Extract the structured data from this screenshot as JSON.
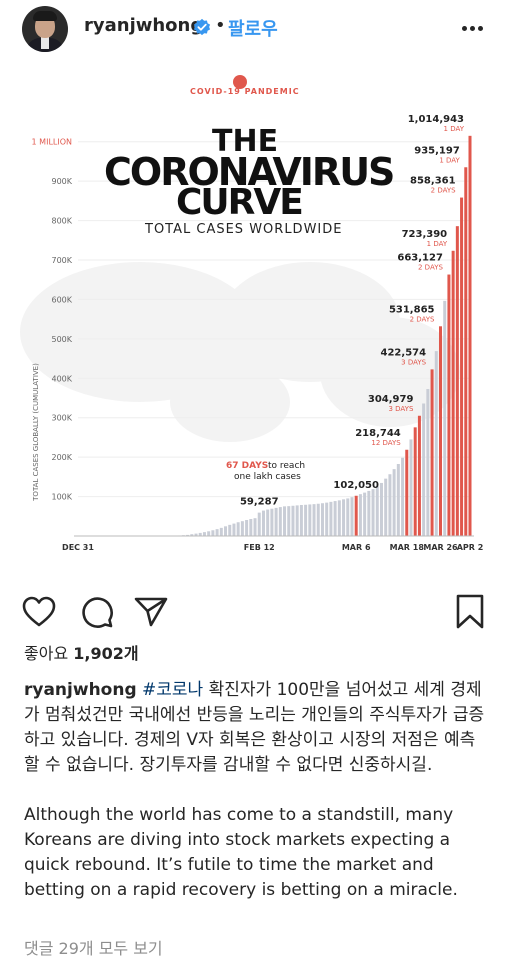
{
  "post": {
    "username": "ryanjwhong",
    "separator": "•",
    "follow_label": "팔로우",
    "likes_prefix": "좋아요",
    "likes_count": "1,902개",
    "caption_user": "ryanjwhong",
    "caption_hashtag": "#코로나",
    "caption_korean": " 확진자가 100만을 넘어섰고 세계 경제가 멈춰섰건만 국내에선 반등을 노리는 개인들의 주식투자가 급증하고 있습니다. 경제의 V자 회복은 환상이고 시장의 저점은 예측할 수 없습니다. 장기투자를 감내할 수 없다면 신중하시길.",
    "caption_english": "Although the world has come to a standstill, many Koreans are diving into stock markets expecting a quick rebound. It’s futile to time the market and betting on a rapid recovery is betting on a miracle.",
    "view_comments": "댓글 29개 모두 보기"
  },
  "colors": {
    "accent_blue": "#3897f0",
    "hashtag": "#00376b",
    "bar_gray": "#c9cdd6",
    "bar_red": "#e0574c",
    "muted": "#8e8e8e"
  },
  "icons": {
    "more": "more-horizontal-icon",
    "like": "heart-icon",
    "comment": "comment-bubble-icon",
    "share": "paper-plane-icon",
    "save": "bookmark-icon",
    "verified": "verified-badge-icon"
  },
  "chart_data": {
    "type": "bar",
    "title_lines": [
      "THE",
      "CORONAVIRUS",
      "CURVE"
    ],
    "subtitle": "TOTAL CASES WORLDWIDE",
    "badge": "COVID-19 PANDEMIC",
    "ylabel": "TOTAL CASES GLOBALLY (CUMULATIVE)",
    "ylim": [
      0,
      1050000
    ],
    "y_ticks": [
      {
        "value": 100000,
        "label": "100K"
      },
      {
        "value": 200000,
        "label": "200K"
      },
      {
        "value": 300000,
        "label": "300K"
      },
      {
        "value": 400000,
        "label": "400K"
      },
      {
        "value": 500000,
        "label": "500K"
      },
      {
        "value": 600000,
        "label": "600K"
      },
      {
        "value": 700000,
        "label": "700K"
      },
      {
        "value": 800000,
        "label": "800K"
      },
      {
        "value": 900000,
        "label": "900K"
      },
      {
        "value": 1000000,
        "label": "1 MILLION"
      }
    ],
    "x_labels": [
      {
        "day": 0,
        "label": "DEC 31"
      },
      {
        "day": 43,
        "label": "FEB 12"
      },
      {
        "day": 66,
        "label": "MAR 6"
      },
      {
        "day": 78,
        "label": "MAR 18"
      },
      {
        "day": 86,
        "label": "MAR 26"
      },
      {
        "day": 93,
        "label": "APR 2"
      }
    ],
    "days": 93,
    "values": [
      27,
      27,
      44,
      44,
      59,
      59,
      59,
      59,
      59,
      59,
      59,
      59,
      59,
      59,
      59,
      59,
      59,
      59,
      59,
      59,
      282,
      314,
      581,
      846,
      1320,
      2014,
      2798,
      4593,
      6065,
      7818,
      9826,
      11953,
      14557,
      17391,
      20630,
      24554,
      28276,
      31481,
      34886,
      37558,
      40554,
      43103,
      45171,
      59287,
      64438,
      67100,
      69197,
      71329,
      73332,
      75184,
      75700,
      76677,
      77673,
      78651,
      79205,
      80087,
      80828,
      81820,
      83112,
      84615,
      86604,
      88585,
      90443,
      93016,
      95314,
      98425,
      102050,
      106099,
      109991,
      114381,
      118948,
      126214,
      134576,
      145483,
      156653,
      169593,
      182605,
      198412,
      218744,
      244902,
      275550,
      304979,
      336075,
      372757,
      422574,
      468905,
      531865,
      596366,
      663127,
      723390,
      785807,
      858361,
      935197,
      1014943
    ],
    "red_days": [
      66,
      78,
      80,
      81,
      84,
      86,
      88,
      89,
      90,
      91,
      92,
      93
    ],
    "annotations": [
      {
        "day": 43,
        "value": "59,287",
        "note": ""
      },
      {
        "day": 66,
        "value": "102,050",
        "note": ""
      },
      {
        "day": 78,
        "value": "218,744",
        "note": "12 DAYS"
      },
      {
        "day": 81,
        "value": "304,979",
        "note": "3 DAYS"
      },
      {
        "day": 84,
        "value": "422,574",
        "note": "3 DAYS"
      },
      {
        "day": 86,
        "value": "531,865",
        "note": "2 DAYS"
      },
      {
        "day": 88,
        "value": "663,127",
        "note": "2 DAYS"
      },
      {
        "day": 89,
        "value": "723,390",
        "note": "1 DAY"
      },
      {
        "day": 91,
        "value": "858,361",
        "note": "2 DAYS"
      },
      {
        "day": 92,
        "value": "935,197",
        "note": "1 DAY"
      },
      {
        "day": 93,
        "value": "1,014,943",
        "note": "1 DAY"
      }
    ],
    "callout": {
      "red": "67 DAYS",
      "rest1": " to reach",
      "rest2": "one lakh cases"
    }
  }
}
